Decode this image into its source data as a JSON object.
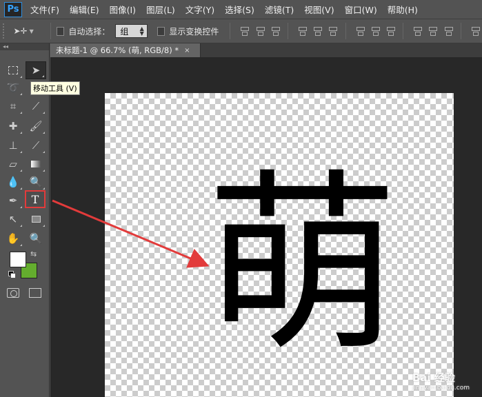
{
  "app": {
    "logo": "Ps"
  },
  "menu": [
    "文件(F)",
    "编辑(E)",
    "图像(I)",
    "图层(L)",
    "文字(Y)",
    "选择(S)",
    "滤镜(T)",
    "视图(V)",
    "窗口(W)",
    "帮助(H)"
  ],
  "options": {
    "auto_select_label": "自动选择：",
    "auto_select_value": "组",
    "show_transform_label": "显示变换控件"
  },
  "tools": {
    "tooltip": "移动工具 (V)",
    "type_tool_glyph": "T",
    "foreground_color": "#ffffff",
    "background_color": "#64ad2e",
    "highlight_color": "#e23b3b"
  },
  "document": {
    "tab_title": "未标题-1 @ 66.7% (萌, RGB/8) *",
    "tab_close": "×",
    "canvas_text": "萌"
  },
  "watermark": {
    "main": "Bai 经验",
    "sub": "jingyan.baidu.com"
  }
}
